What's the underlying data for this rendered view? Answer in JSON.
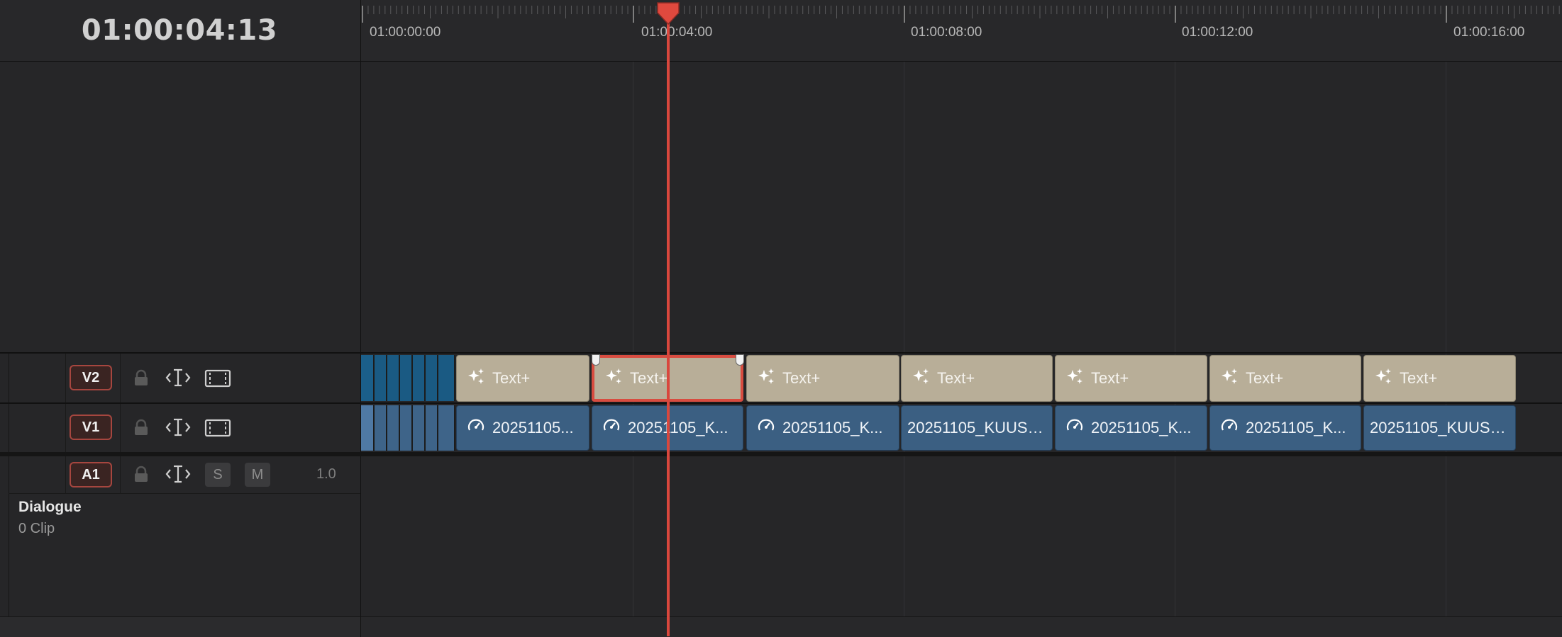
{
  "timecode": "01:00:04:13",
  "ruler": {
    "labels": [
      "01:00:00:00",
      "01:00:04:00",
      "01:00:08:00",
      "01:00:12:00",
      "01:00:16:00"
    ]
  },
  "tracks": {
    "v2": {
      "label": "V2"
    },
    "v1": {
      "label": "V1"
    },
    "a1": {
      "label": "A1",
      "solo_label": "S",
      "mute_label": "M",
      "volume": "1.0",
      "name": "Dialogue",
      "clip_count": "0 Clip"
    }
  },
  "v2_clips": [
    "Text+",
    "Text+",
    "Text+",
    "Text+",
    "Text+",
    "Text+",
    "Text+"
  ],
  "v1_clips": [
    "20251105...",
    "20251105_K...",
    "20251105_K...",
    "20251105_KUUS_...",
    "20251105_K...",
    "20251105_K...",
    "20251105_KUUS_..."
  ],
  "colors": {
    "playhead": "#d9473d",
    "title_clip": "#b8ae98",
    "video_clip": "#3b5f82",
    "track_badge_border": "#a6463f"
  },
  "icons": {
    "title_clip_icon": "sparkle-icon",
    "video_clip_icon": "speedometer-icon",
    "lock": "lock-icon",
    "auto_select": "auto-select-icon",
    "track_toggle": "film-strip-icon"
  }
}
